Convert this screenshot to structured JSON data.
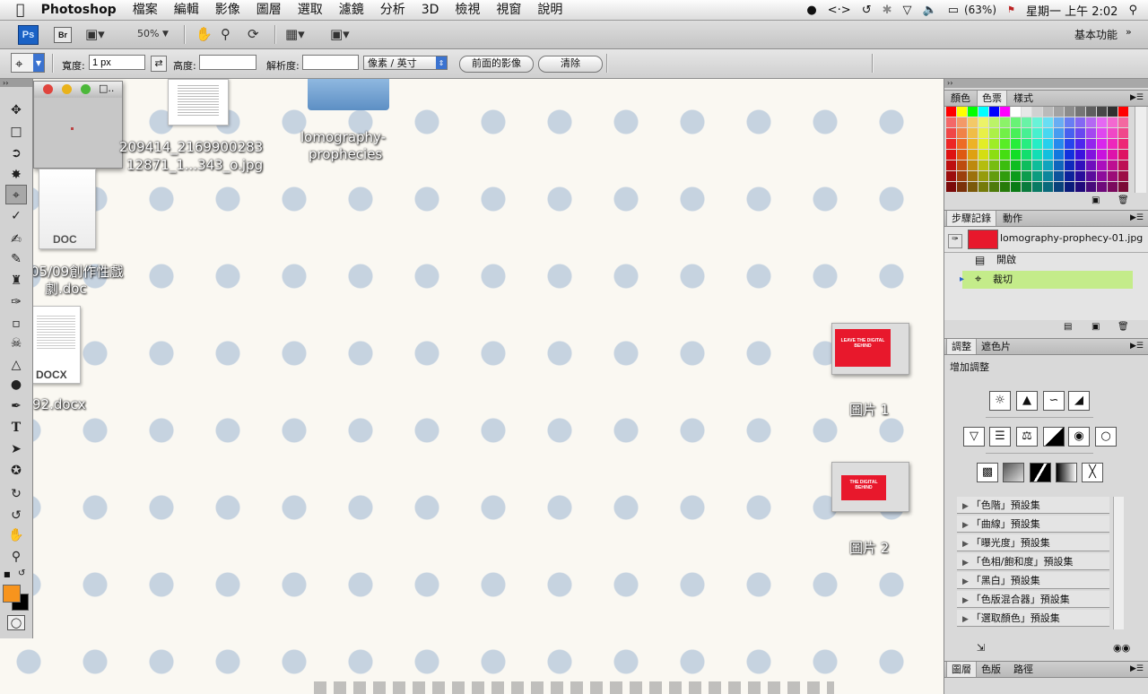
{
  "menubar": {
    "app_name": "Photoshop",
    "items": [
      "檔案",
      "編輯",
      "影像",
      "圖層",
      "選取",
      "濾鏡",
      "分析",
      "3D",
      "檢視",
      "視窗",
      "說明"
    ],
    "battery": "(63%)",
    "clock": "星期一 上午 2:02"
  },
  "appbar": {
    "ps_badge": "Ps",
    "br_badge": "Br",
    "zoom": "50%",
    "workspace": "基本功能"
  },
  "options": {
    "width_label": "寬度:",
    "width_value": "1 px",
    "height_label": "高度:",
    "height_value": "",
    "resolution_label": "解析度:",
    "resolution_value": "",
    "unit_select": "像素 / 英寸",
    "front_image_button": "前面的影像",
    "clear_button": "清除"
  },
  "desktop": {
    "files": [
      {
        "name_line1": "209414_2169900283",
        "name_line2": "12871_1...343_o.jpg"
      },
      {
        "name_line1": "lomography-",
        "name_line2": "prophecies"
      },
      {
        "badge": "DOC",
        "name_line1": "05/09創作性戲",
        "name_line2": "劇.doc"
      },
      {
        "badge": "DOCX",
        "name_line1": "92.docx"
      }
    ],
    "screenshots": [
      {
        "label": "圖片 1",
        "thumb_text": "LEAVE THE DIGITAL BEHIND"
      },
      {
        "label": "圖片 2",
        "thumb_text": "THE DIGITAL BEHIND"
      }
    ]
  },
  "panels": {
    "swatches": {
      "tabs": [
        "顏色",
        "色票",
        "樣式"
      ]
    },
    "history": {
      "tabs": [
        "步驟記錄",
        "動作"
      ],
      "snapshot": "lomography-prophecy-01.jpg",
      "steps": [
        "開啟",
        "裁切"
      ]
    },
    "adjustments": {
      "tabs": [
        "調整",
        "遮色片"
      ],
      "title": "增加調整",
      "presets": [
        "「色階」預設集",
        "「曲線」預設集",
        "「曝光度」預設集",
        "「色相/飽和度」預設集",
        "「黑白」預設集",
        "「色版混合器」預設集",
        "「選取顏色」預設集"
      ]
    },
    "layers": {
      "tabs": [
        "圖層",
        "色版",
        "路徑"
      ]
    }
  },
  "colors": {
    "foreground": "#f7941d",
    "background": "#000000",
    "history_active": "#c4ec8a"
  }
}
